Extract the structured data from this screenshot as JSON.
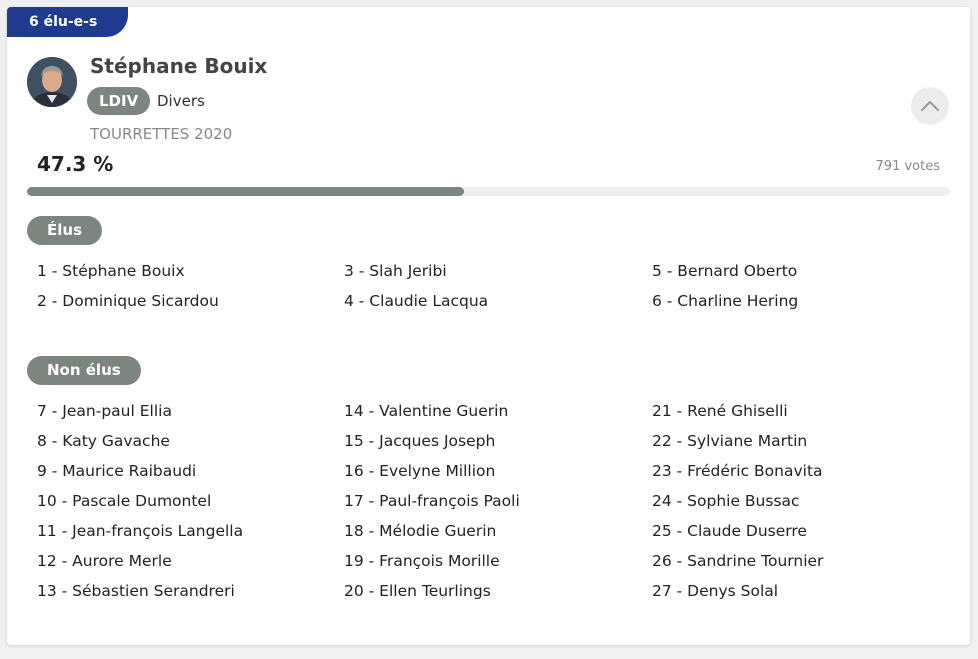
{
  "card": {
    "badge": "6 élu-e-s",
    "candidate_name": "Stéphane Bouix",
    "party_code": "LDIV",
    "party_name": "Divers",
    "list_label": "TOURRETTES 2020",
    "score_text": "47.3 %",
    "score_fraction": 0.473,
    "votes_text": "791 votes",
    "collapse_icon": "chevron-up-icon",
    "colors": {
      "badge_bg": "#1f3a8f",
      "pill_bg": "#7c8580",
      "bar_track": "#eeeeee"
    }
  },
  "elus": {
    "label": "Élus",
    "members": [
      "1 - Stéphane Bouix",
      "2 - Dominique Sicardou",
      "3 - Slah Jeribi",
      "4 - Claudie Lacqua",
      "5 - Bernard Oberto",
      "6 - Charline Hering"
    ]
  },
  "non_elus": {
    "label": "Non élus",
    "members": [
      "7 - Jean-paul Ellia",
      "8 - Katy Gavache",
      "9 - Maurice Raibaudi",
      "10 - Pascale Dumontel",
      "11 - Jean-françois Langella",
      "12 - Aurore Merle",
      "13 - Sébastien Serandreri",
      "14 - Valentine Guerin",
      "15 - Jacques Joseph",
      "16 - Evelyne Million",
      "17 - Paul-françois Paoli",
      "18 - Mélodie Guerin",
      "19 - François Morille",
      "20 - Ellen Teurlings",
      "21 - René Ghiselli",
      "22 - Sylviane Martin",
      "23 - Frédéric Bonavita",
      "24 - Sophie Bussac",
      "25 - Claude Duserre",
      "26 - Sandrine Tournier",
      "27 - Denys Solal"
    ]
  }
}
